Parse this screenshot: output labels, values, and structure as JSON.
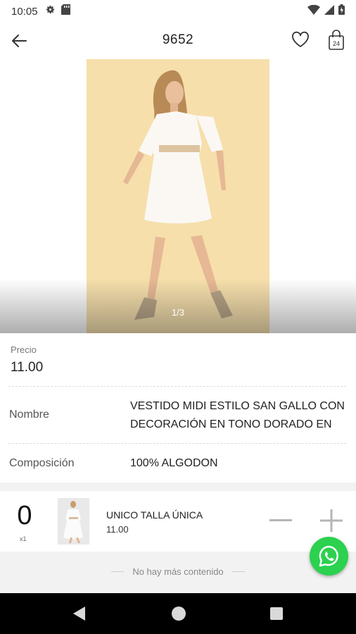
{
  "status_bar": {
    "time": "10:05"
  },
  "app_bar": {
    "title": "9652",
    "cart_count": "24"
  },
  "gallery": {
    "counter": "1/3"
  },
  "product": {
    "price_label": "Precio",
    "price": "11.00",
    "name_label": "Nombre",
    "name_line1": "VESTIDO MIDI ESTILO SAN GALLO CON",
    "name_line2": "DECORACIÓN EN TONO DORADO EN",
    "composition_label": "Composición",
    "composition": "100% ALGODON"
  },
  "variant": {
    "quantity": "0",
    "unit": "x1",
    "name": "UNICO  TALLA ÚNICA",
    "price": "11.00"
  },
  "footer": {
    "end_text": "No hay más contenido"
  },
  "colors": {
    "accent_whatsapp": "#2bd14f",
    "photo_background": "#f6dfab"
  }
}
